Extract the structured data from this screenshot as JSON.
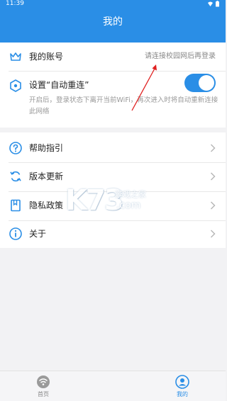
{
  "status_bar": {
    "time": "11:39"
  },
  "header": {
    "title": "我的"
  },
  "account": {
    "label": "我的账号",
    "value": "请连接校园网后再登录"
  },
  "auto_reconnect": {
    "label": "设置“自动重连”",
    "description": "开启后，登录状态下离开当前WiFi，再次进入时将自动重新连接此网络",
    "enabled": true
  },
  "menu": [
    {
      "label": "帮助指引",
      "icon": "help-circle-icon"
    },
    {
      "label": "版本更新",
      "icon": "refresh-icon"
    },
    {
      "label": "隐私政策",
      "icon": "book-icon"
    },
    {
      "label": "关于",
      "icon": "info-icon"
    }
  ],
  "watermark": {
    "brand": "K73",
    "site": "游戏之家",
    "domain": ".com"
  },
  "bottom_nav": [
    {
      "label": "首页",
      "icon": "wifi-icon",
      "active": false
    },
    {
      "label": "我的",
      "icon": "user-icon",
      "active": true
    }
  ],
  "colors": {
    "accent": "#2a8ee6",
    "arrow": "#e02020"
  }
}
